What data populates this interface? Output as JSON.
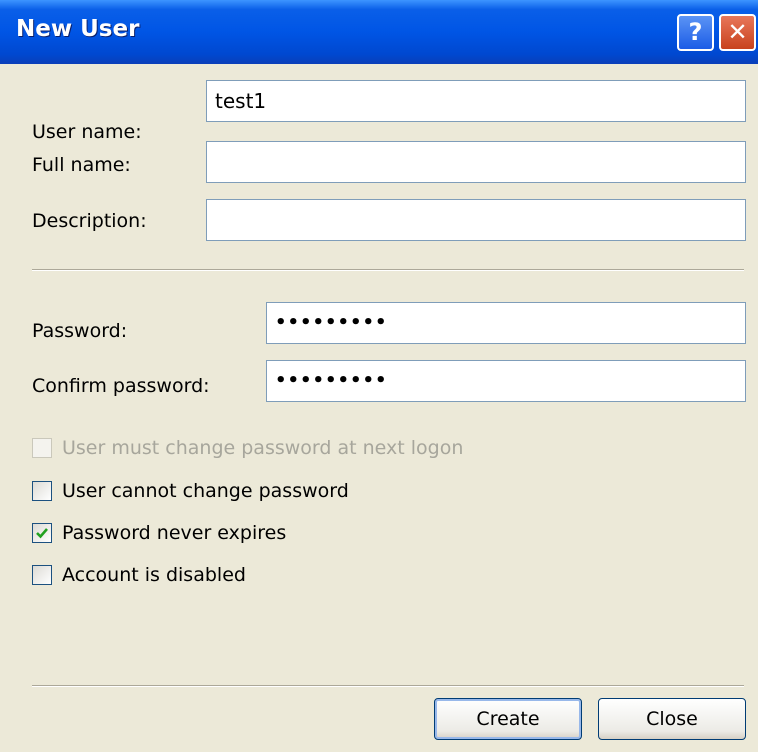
{
  "title": "New User",
  "title_buttons": {
    "help": "?",
    "close": "✕"
  },
  "fields": [
    {
      "label": "User name:",
      "value": "test1"
    },
    {
      "label": "Full name:",
      "value": ""
    },
    {
      "label": "Description:",
      "value": ""
    },
    {
      "label": "Password:",
      "value": "•••••••••"
    },
    {
      "label": "Confirm password:",
      "value": "•••••••••"
    }
  ],
  "checkboxes": [
    {
      "label": "User must change password at next logon",
      "checked": false,
      "disabled": true
    },
    {
      "label": "User cannot change password",
      "checked": false,
      "disabled": false
    },
    {
      "label": "Password never expires",
      "checked": true,
      "disabled": false
    },
    {
      "label": "Account is disabled",
      "checked": false,
      "disabled": false
    }
  ],
  "buttons": {
    "create": "Create",
    "close": "Close"
  },
  "colors": {
    "titlebar": "#0055e5",
    "dialog_bg": "#ece9d8",
    "check": "#21a121"
  }
}
